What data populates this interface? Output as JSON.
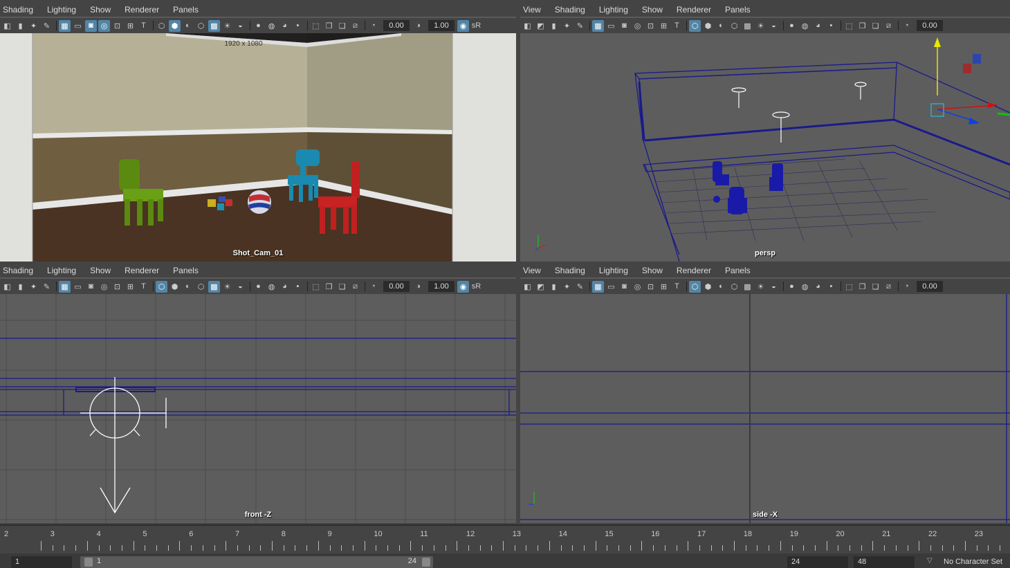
{
  "menus_left": [
    "Shading",
    "Lighting",
    "Show",
    "Renderer",
    "Panels"
  ],
  "menus_right": [
    "View",
    "Shading",
    "Lighting",
    "Show",
    "Renderer",
    "Panels"
  ],
  "toolbar": {
    "exposure": "0.00",
    "gamma": "1.00",
    "colorspace": "sR"
  },
  "viewports": {
    "top_left": {
      "label": "Shot_Cam_01",
      "resolution": "1920 x 1080"
    },
    "top_right": {
      "label": "persp"
    },
    "bottom_left": {
      "label": "front -Z"
    },
    "bottom_right": {
      "label": "side -X"
    }
  },
  "timeline": {
    "frames": [
      "2",
      "3",
      "4",
      "5",
      "6",
      "7",
      "8",
      "9",
      "10",
      "11",
      "12",
      "13",
      "14",
      "15",
      "16",
      "17",
      "18",
      "19",
      "20",
      "21",
      "22",
      "23"
    ]
  },
  "range": {
    "start": "1",
    "slider_start": "1",
    "slider_end": "24",
    "end": "24",
    "anim_end": "48",
    "character_set": "No Character Set"
  },
  "colors": {
    "wireframe": "#1a1a8c",
    "accent": "#5285a6",
    "green_chair": "#5a8a10",
    "blue_chair": "#1a8ab0",
    "red_chair": "#c02020"
  }
}
